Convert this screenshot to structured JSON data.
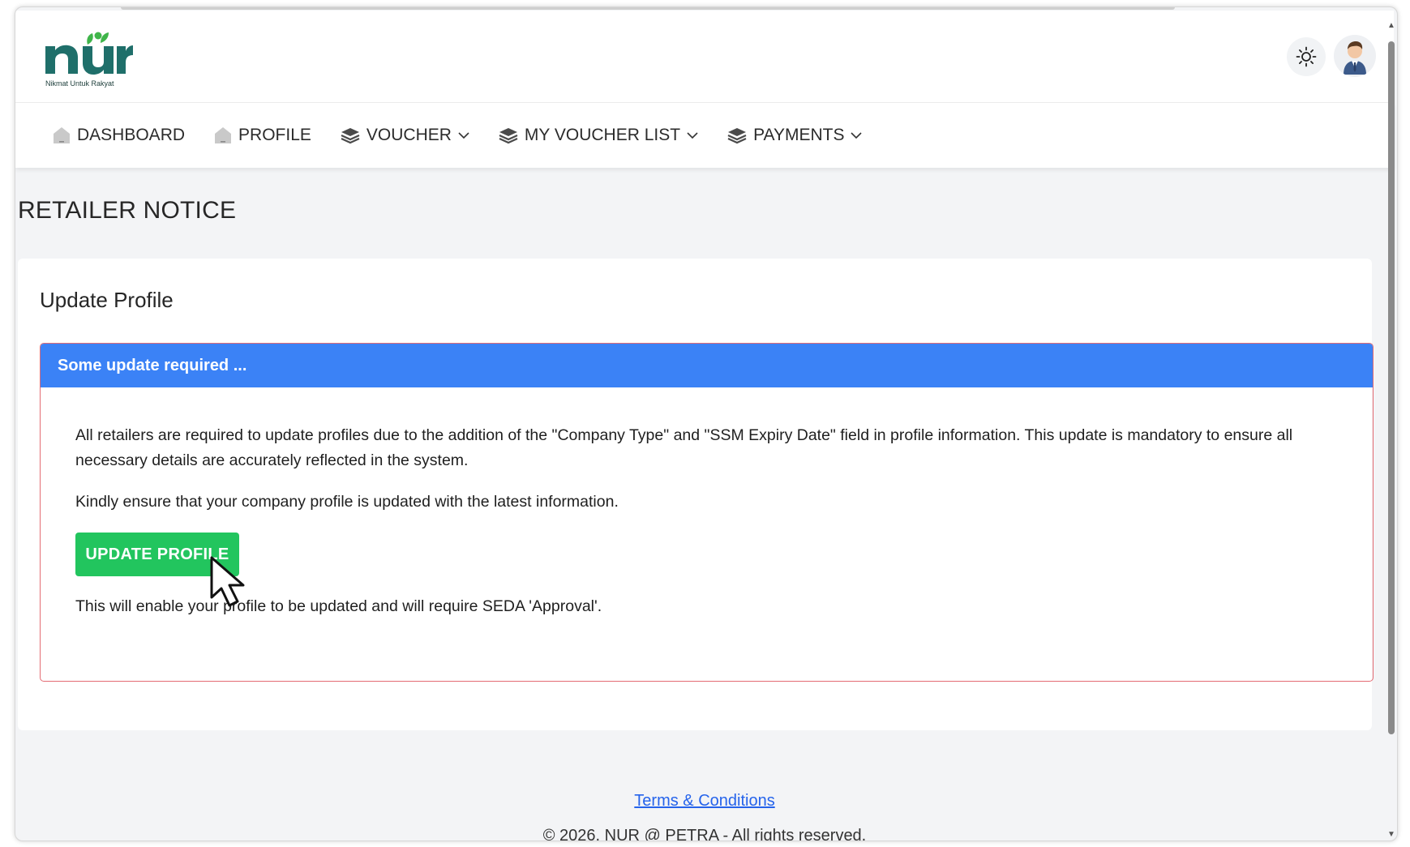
{
  "header": {
    "logo_tagline": "Nikmat Untuk Rakyat"
  },
  "nav": {
    "items": [
      {
        "label": "DASHBOARD",
        "icon": "home-icon",
        "dropdown": false
      },
      {
        "label": "PROFILE",
        "icon": "home-icon",
        "dropdown": false
      },
      {
        "label": "VOUCHER",
        "icon": "layers-icon",
        "dropdown": true
      },
      {
        "label": "MY VOUCHER LIST",
        "icon": "layers-icon",
        "dropdown": true
      },
      {
        "label": "PAYMENTS",
        "icon": "layers-icon",
        "dropdown": true
      }
    ]
  },
  "page": {
    "title": "RETAILER NOTICE"
  },
  "card": {
    "title": "Update Profile",
    "notice_header": "Some update required ...",
    "paragraph1": "All retailers are required to update profiles due to the addition of the \"Company Type\" and \"SSM Expiry Date\" field in profile information. This update is mandatory to ensure all necessary details are accurately reflected in the system.",
    "paragraph2": "Kindly ensure that your company profile is updated with the latest information.",
    "button_label": "UPDATE PROFILE",
    "paragraph3": "This will enable your profile to be updated and will require SEDA 'Approval'."
  },
  "footer": {
    "terms_link": "Terms & Conditions",
    "copyright": "© 2026. NUR @ PETRA - All rights reserved."
  },
  "colors": {
    "notice_header_bg": "#3b82f6",
    "button_bg": "#22c55e",
    "notice_border": "#e46c74",
    "link": "#2563eb",
    "logo_teal": "#1f6f6a",
    "logo_green": "#3fb54a"
  }
}
